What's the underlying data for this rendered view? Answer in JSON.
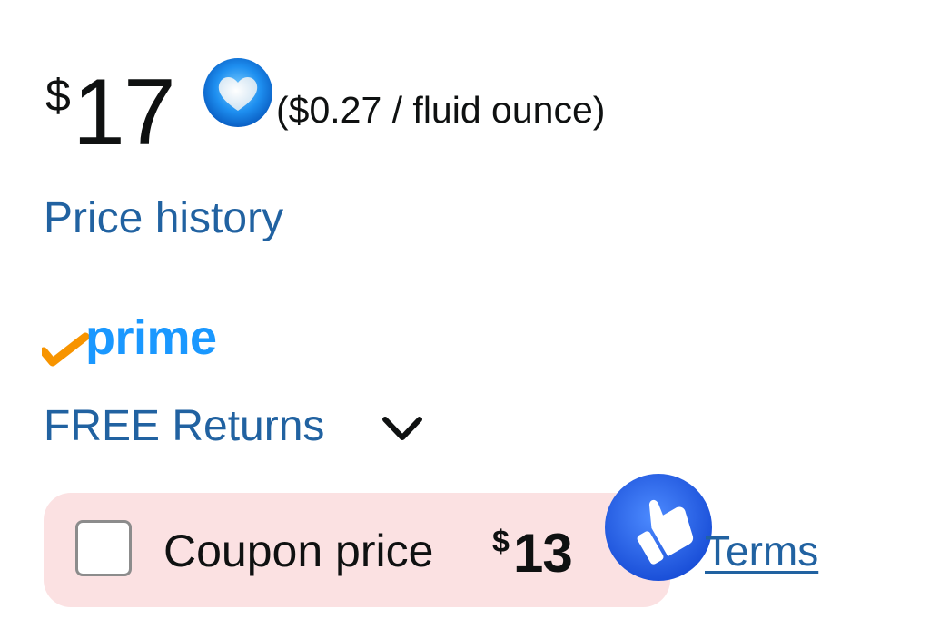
{
  "price": {
    "currency_symbol": "$",
    "whole": "17",
    "unit_price": "($0.27 / fluid ounce)"
  },
  "price_history": {
    "label": "Price history"
  },
  "prime": {
    "logo_text": "prime",
    "check_color": "#f79400",
    "text_color": "#1a98ff"
  },
  "returns": {
    "label": "FREE Returns",
    "chevron_icon": "chevron-down-icon"
  },
  "coupon": {
    "checked": false,
    "label": "Coupon price",
    "currency_symbol": "$",
    "value": "13",
    "terms_label": "Terms",
    "background_color": "#fbe1e2"
  },
  "overlays": {
    "heart_icon": "heart-icon",
    "thumbs_up_icon": "thumbs-up-icon"
  },
  "colors": {
    "link": "#2162a1",
    "text": "#0f1111"
  }
}
